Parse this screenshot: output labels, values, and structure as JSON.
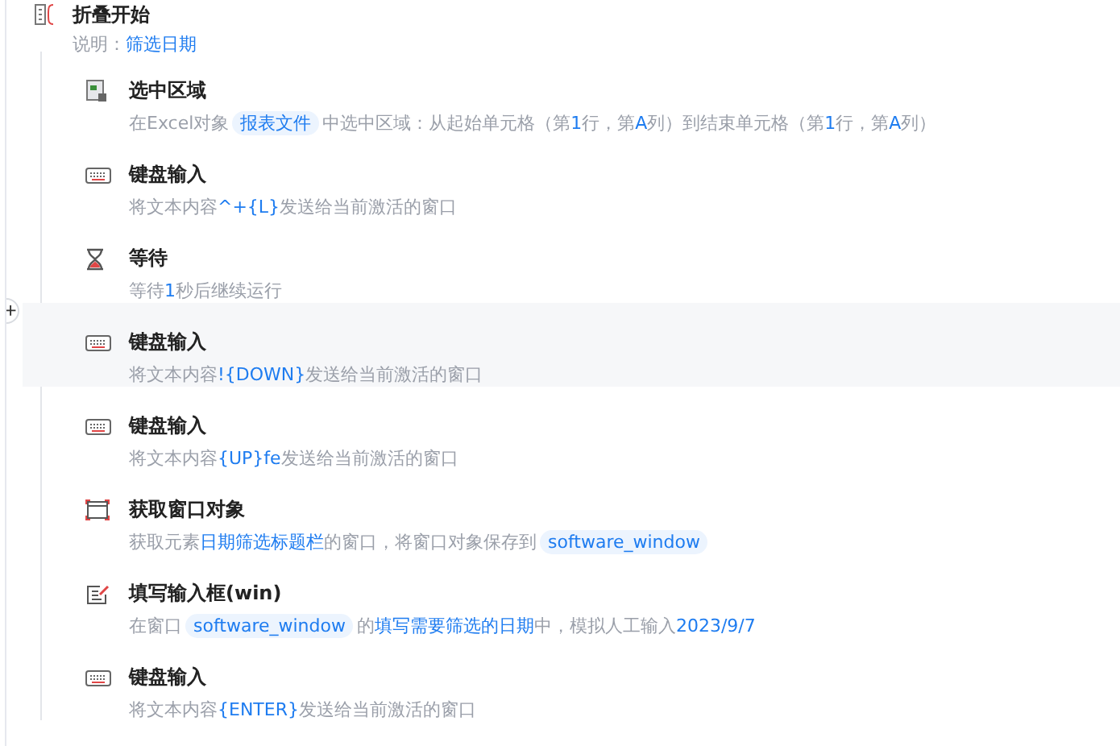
{
  "group": {
    "title": "折叠开始",
    "note_label": "说明：",
    "note_value": "筛选日期"
  },
  "add_button": {
    "label": "+"
  },
  "steps": [
    {
      "kind": "range",
      "title": "选中区域",
      "highlighted": false,
      "description": [
        {
          "kind": "plain",
          "text": "在Excel对象"
        },
        {
          "kind": "chip",
          "text": "报表文件"
        },
        {
          "kind": "plain",
          "text": "中选中区域：从起始单元格（第"
        },
        {
          "kind": "value",
          "text": "1"
        },
        {
          "kind": "plain",
          "text": "行，第"
        },
        {
          "kind": "value",
          "text": "A"
        },
        {
          "kind": "plain",
          "text": "列）到结束单元格（第"
        },
        {
          "kind": "value",
          "text": "1"
        },
        {
          "kind": "plain",
          "text": "行，第"
        },
        {
          "kind": "value",
          "text": "A"
        },
        {
          "kind": "plain",
          "text": "列）"
        }
      ]
    },
    {
      "kind": "keyboard",
      "title": "键盘输入",
      "highlighted": false,
      "description": [
        {
          "kind": "plain",
          "text": "将文本内容"
        },
        {
          "kind": "value",
          "text": "^+{L}"
        },
        {
          "kind": "plain",
          "text": "发送给当前激活的窗口"
        }
      ]
    },
    {
      "kind": "wait",
      "title": "等待",
      "highlighted": false,
      "description": [
        {
          "kind": "plain",
          "text": "等待"
        },
        {
          "kind": "value",
          "text": "1"
        },
        {
          "kind": "plain",
          "text": "秒后继续运行"
        }
      ]
    },
    {
      "kind": "keyboard",
      "title": "键盘输入",
      "highlighted": true,
      "description": [
        {
          "kind": "plain",
          "text": "将文本内容"
        },
        {
          "kind": "value",
          "text": "!{DOWN}"
        },
        {
          "kind": "plain",
          "text": "发送给当前激活的窗口"
        }
      ]
    },
    {
      "kind": "keyboard",
      "title": "键盘输入",
      "highlighted": false,
      "description": [
        {
          "kind": "plain",
          "text": "将文本内容"
        },
        {
          "kind": "value",
          "text": "{UP}fe"
        },
        {
          "kind": "plain",
          "text": "发送给当前激活的窗口"
        }
      ]
    },
    {
      "kind": "window",
      "title": "获取窗口对象",
      "highlighted": false,
      "description": [
        {
          "kind": "plain",
          "text": "获取元素"
        },
        {
          "kind": "value",
          "text": "日期筛选标题栏"
        },
        {
          "kind": "plain",
          "text": "的窗口，将窗口对象保存到"
        },
        {
          "kind": "chip",
          "text": "software_window"
        }
      ]
    },
    {
      "kind": "input",
      "title": "填写输入框(win)",
      "highlighted": false,
      "description": [
        {
          "kind": "plain",
          "text": "在窗口"
        },
        {
          "kind": "chip",
          "text": "software_window"
        },
        {
          "kind": "plain",
          "text": "的"
        },
        {
          "kind": "value",
          "text": "填写需要筛选的日期"
        },
        {
          "kind": "plain",
          "text": "中，模拟人工输入"
        },
        {
          "kind": "value",
          "text": "2023/9/7"
        }
      ]
    },
    {
      "kind": "keyboard",
      "title": "键盘输入",
      "highlighted": false,
      "description": [
        {
          "kind": "plain",
          "text": "将文本内容"
        },
        {
          "kind": "value",
          "text": "{ENTER}"
        },
        {
          "kind": "plain",
          "text": "发送给当前激活的窗口"
        }
      ]
    }
  ]
}
